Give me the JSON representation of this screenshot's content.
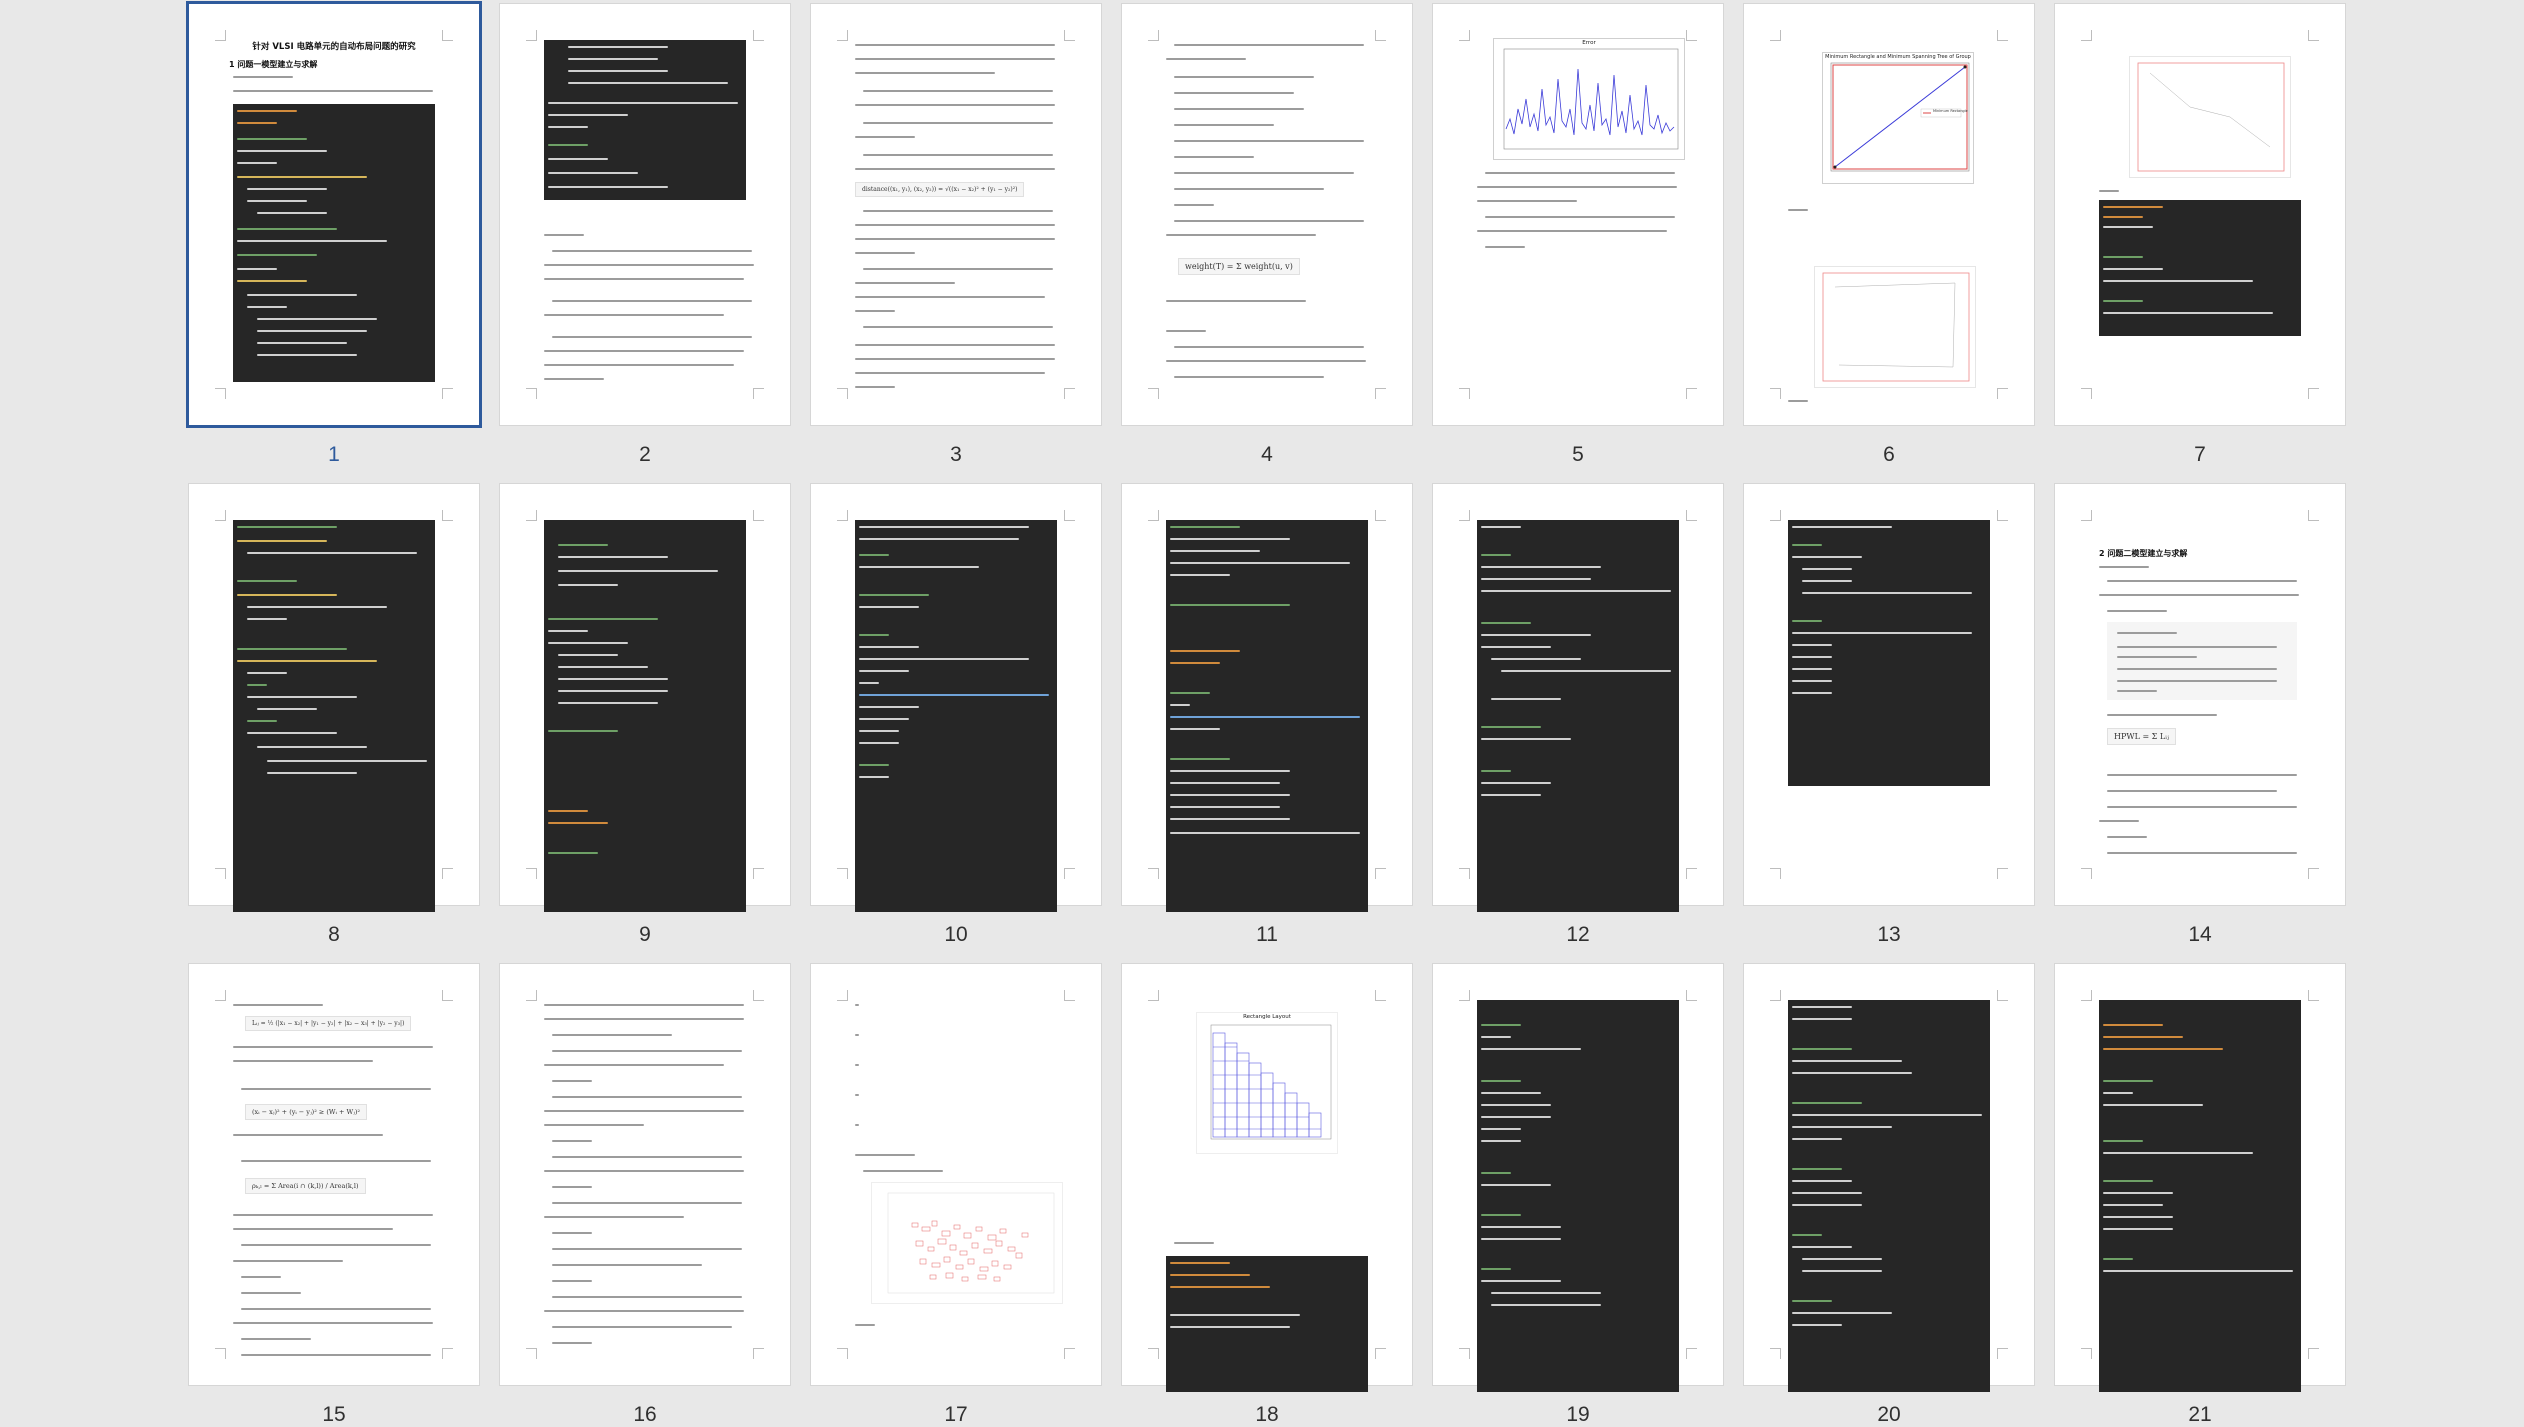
{
  "document": {
    "title": "针对 VLSI 电路单元的自动布局问题的研究",
    "section_1": "1 问题一模型建立与求解",
    "section_2": "2 问题二模型建立与求解"
  },
  "pages": [
    {
      "number": "1",
      "selected": true
    },
    {
      "number": "2"
    },
    {
      "number": "3"
    },
    {
      "number": "4"
    },
    {
      "number": "5"
    },
    {
      "number": "6"
    },
    {
      "number": "7"
    },
    {
      "number": "8"
    },
    {
      "number": "9"
    },
    {
      "number": "10"
    },
    {
      "number": "11"
    },
    {
      "number": "12"
    },
    {
      "number": "13"
    },
    {
      "number": "14"
    },
    {
      "number": "15"
    },
    {
      "number": "16"
    },
    {
      "number": "17"
    },
    {
      "number": "18"
    },
    {
      "number": "19"
    },
    {
      "number": "20"
    },
    {
      "number": "21"
    }
  ],
  "figures": {
    "p5_chart_title": "Error",
    "p6_chart_title": "Minimum Rectangle and Minimum Spanning Tree of Group",
    "p6_legend": "Minimum Rectangle",
    "p18_chart_title": "Rectangle Layout"
  },
  "formulas": {
    "distance": "distance((x₁, y₁), (x₂, y₂)) = √((x₁ − x₂)² + (y₁ − y₂)²)",
    "weight": "weight(T) = Σ weight(u, v)",
    "hpwl": "HPWL = Σ Lᵢⱼ",
    "lij": "Lᵢⱼ = ½ (|x₁ − x₂| + |y₁ − y₂| + |x₂ − x₃| + |y₂ − y₃|)",
    "overlap": "(xᵢ − xⱼ)² + (yᵢ − yⱼ)² ≥ (Wᵢ + Wⱼ)²",
    "density": "ρₖ,ₗ = Σ Area(i ∩ (k,l)) / Area(k,l)"
  },
  "colors": {
    "selection": "#2e5a9c",
    "code_background": "#262626",
    "page_background": "#ffffff",
    "workspace_background": "#e8e8e8"
  }
}
